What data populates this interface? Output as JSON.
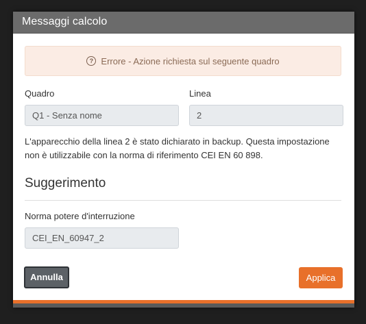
{
  "dialog": {
    "title": "Messaggi calcolo"
  },
  "alert": {
    "icon": "question-circle-icon",
    "text": "Errore - Azione richiesta sul seguente quadro"
  },
  "fields": {
    "quadro_label": "Quadro",
    "quadro_value": "Q1 - Senza nome",
    "linea_label": "Linea",
    "linea_value": "2"
  },
  "message": {
    "line1": "L'apparecchio della linea 2 è stato dichiarato in backup. Questa impostazione",
    "line2": "non è utilizzabile con la norma di riferimento CEI EN 60 898."
  },
  "suggestion": {
    "title": "Suggerimento",
    "norma_label": "Norma potere d'interruzione",
    "norma_value": "CEI_EN_60947_2"
  },
  "buttons": {
    "cancel_label": "Annulla",
    "apply_label": "Applica"
  },
  "colors": {
    "accent": "#e8702a",
    "header": "#6b6b6b",
    "alert_bg": "#fbece4"
  }
}
